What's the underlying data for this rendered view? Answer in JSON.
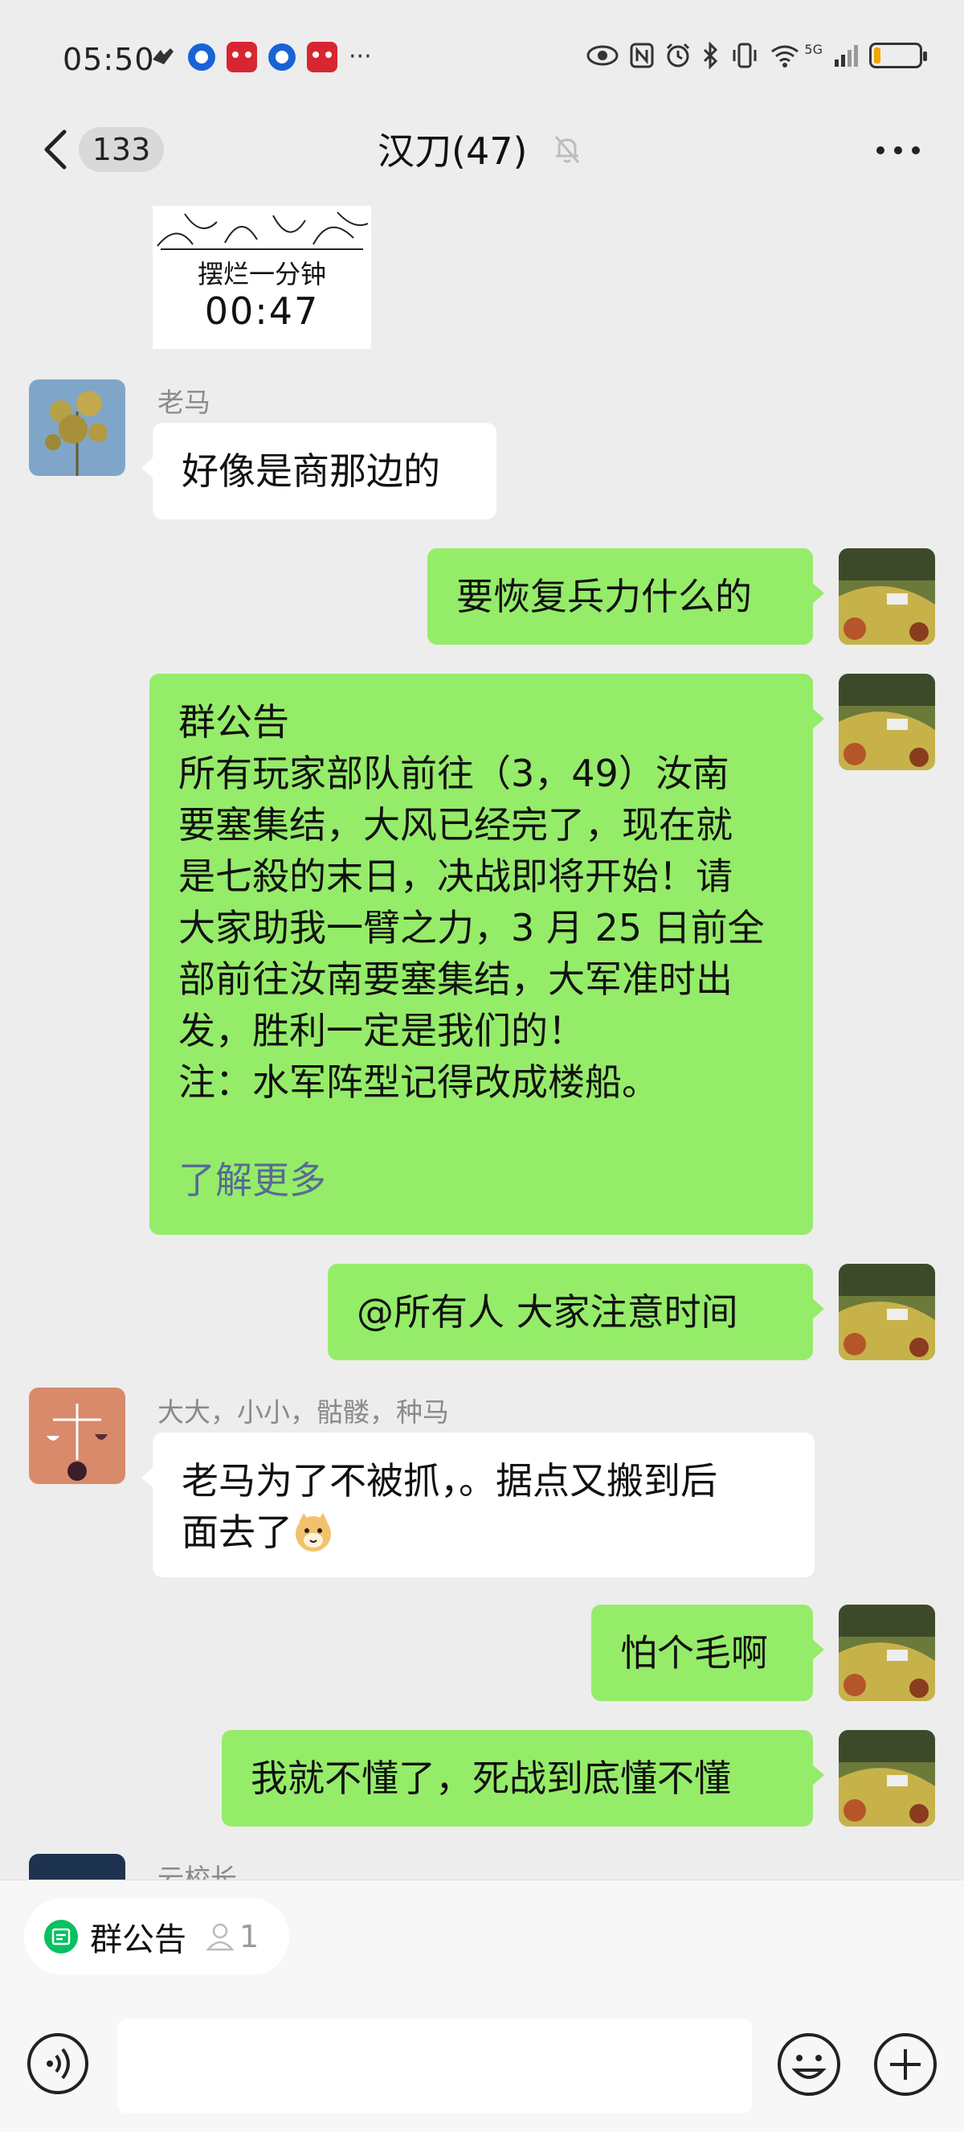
{
  "status_bar": {
    "time": "05:50",
    "more": "···",
    "network": "5G",
    "icons": [
      "eye-icon",
      "nfc-icon",
      "alarm-icon",
      "bluetooth-icon",
      "vibrate-icon",
      "wifi-icon",
      "signal-icon",
      "battery-icon"
    ],
    "battery_level": 0.15
  },
  "header": {
    "unread_count": "133",
    "title": "汉刀(47)",
    "icons": [
      "back-icon",
      "mute-bell-icon",
      "more-icon"
    ]
  },
  "messages": {
    "sticker": {
      "line1": "摆烂一分钟",
      "line2": "00:47"
    },
    "m1": {
      "sender": "老马",
      "text": "好像是商那边的"
    },
    "m2": {
      "text": "要恢复兵力什么的"
    },
    "notice": {
      "title": "群公告",
      "body": "所有玩家部队前往（3，49）汝南\n要塞集结，大风已经完了，现在就\n是七殺的末日，决战即将开始！请\n大家助我一臂之力，3 月 25 日前全\n部前往汝南要塞集结，大军准时出\n发，胜利一定是我们的！\n注：水军阵型记得改成楼船。",
      "more": "了解更多"
    },
    "m3": {
      "text": "@所有人  大家注意时间"
    },
    "m4": {
      "sender": "大大，小小，骷髅，种马",
      "text_line1": "老马为了不被抓，。据点又搬到后",
      "text_line2": "面去了"
    },
    "m5": {
      "text": "怕个毛啊"
    },
    "m6": {
      "text": "我就不懂了，死战到底懂不懂"
    },
    "m7": {
      "sender": "云校长"
    }
  },
  "bottom": {
    "pinned_label": "群公告",
    "pinned_count": "1",
    "input_value": "",
    "icons": [
      "voice-icon",
      "emoji-icon",
      "plus-icon"
    ]
  }
}
